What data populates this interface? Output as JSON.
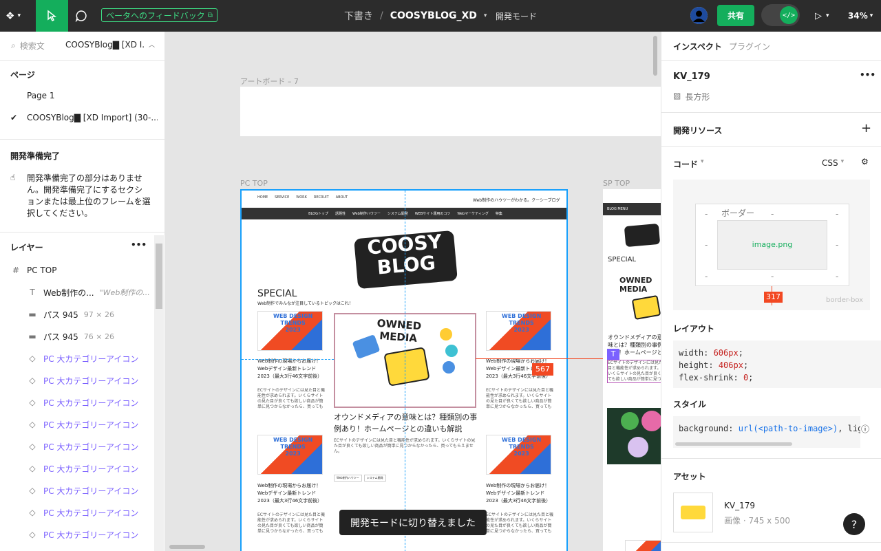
{
  "topbar": {
    "beta_feedback": "ベータへのフィードバック",
    "draft": "下書き",
    "separator": "/",
    "file_name": "COOSYBLOG_XD",
    "dev_mode": "開発モード",
    "share": "共有",
    "dev_toggle_icon": "</>",
    "zoom": "34%",
    "accent": "#14ae5c"
  },
  "left": {
    "search_placeholder": "検索文",
    "file_short": "COOSYBlog▇ [XD I...",
    "pages_title": "ページ",
    "pages": [
      "Page 1",
      "COOSYBlog▇ [XD Import] (30-..."
    ],
    "ready_title": "開発準備完了",
    "ready_text": "開発準備完了の部分はありません。開発準備完了にするセクションまたは最上位のフレームを選択してください。",
    "layers_title": "レイヤー",
    "layers": [
      {
        "icon": "#",
        "name": "PC TOP",
        "meta": ""
      },
      {
        "icon": "T",
        "name": "Web制作の...",
        "meta": "\"Web制作の..."
      },
      {
        "icon": "▬",
        "name": "パス 945",
        "meta": "97 × 26"
      },
      {
        "icon": "▬",
        "name": "パス 945",
        "meta": "76 × 26"
      },
      {
        "icon": "◇",
        "name": "PC 大カテゴリーアイコン",
        "meta": ""
      },
      {
        "icon": "◇",
        "name": "PC 大カテゴリーアイコン",
        "meta": ""
      },
      {
        "icon": "◇",
        "name": "PC 大カテゴリーアイコン",
        "meta": ""
      },
      {
        "icon": "◇",
        "name": "PC 大カテゴリーアイコン",
        "meta": ""
      },
      {
        "icon": "◇",
        "name": "PC 大カテゴリーアイコン",
        "meta": ""
      },
      {
        "icon": "◇",
        "name": "PC 大カテゴリーアイコン",
        "meta": ""
      },
      {
        "icon": "◇",
        "name": "PC 大カテゴリーアイコン",
        "meta": ""
      },
      {
        "icon": "◇",
        "name": "PC 大カテゴリーアイコン",
        "meta": ""
      },
      {
        "icon": "◇",
        "name": "PC 大カテゴリーアイコン",
        "meta": ""
      }
    ]
  },
  "canvas": {
    "artboard7": "アートボード – 7",
    "pc_top": "PC TOP",
    "sp_top": "SP TOP",
    "nav": [
      "HOME",
      "SERVICE",
      "WORK",
      "RECRUIT",
      "ABOUT"
    ],
    "tagline": "Web制作のハウツーがわかる。クーシーブログ",
    "menu": [
      "BLOGトップ",
      "話題性",
      "Web制作ハウツー",
      "システム開発",
      "WEBサイト運用のコツ",
      "Webマーケティング",
      "特集"
    ],
    "logo_line1": "COOSY",
    "logo_line2": "BLOG",
    "special": "SPECIAL",
    "special_sub": "Web制作でみんなが注目しているトピックはこれ！",
    "owned_media_1": "OWNED",
    "owned_media_2": "MEDIA",
    "feature_title": "オウンドメディアの意味とは？種類別の事例あり！ホームページとの違いも解説",
    "card_title": "Web制作の現場からお届け！ Webデザイン最新トレンド2023（最大3行46文字前後）",
    "card_body": "ECサイトのデザインには見た目と機能性が求められます。いくらサイトの見た目が良くても欲しい商品が簡単に見つからなかったら、買ってもらえません。",
    "tags": [
      "Web制作ハウツー",
      "システム開発"
    ],
    "trends_1": "WEB DESIGN",
    "trends_2": "TRENDS",
    "trends_3": "2023",
    "sp_blog_menu": "BLOG MENU",
    "sp_special": "SPECIAL",
    "measure_567": "567",
    "toast": "開発モードに切り替えました"
  },
  "right": {
    "tabs": [
      "インスペクト",
      "プラグイン"
    ],
    "layer_name": "KV_179",
    "layer_type": "長方形",
    "dev_resources": "開発リソース",
    "code": "コード",
    "code_lang": "CSS",
    "border_label": "ボーダー",
    "image_label": "image.png",
    "dash": "-",
    "bottom_measure": "317",
    "border_box": "border-box",
    "layout_title": "レイアウト",
    "layout_code": [
      {
        "prop": "width",
        "val": "606px"
      },
      {
        "prop": "height",
        "val": "406px"
      },
      {
        "prop": "flex-shrink",
        "val": "0"
      }
    ],
    "style_title": "スタイル",
    "style_prop": "background",
    "style_fn": "url(<path-to-image>)",
    "style_rest": ", lightgray",
    "assets_title": "アセット",
    "asset_name": "KV_179",
    "asset_meta": "画像 · 745 x 500",
    "help": "?"
  }
}
